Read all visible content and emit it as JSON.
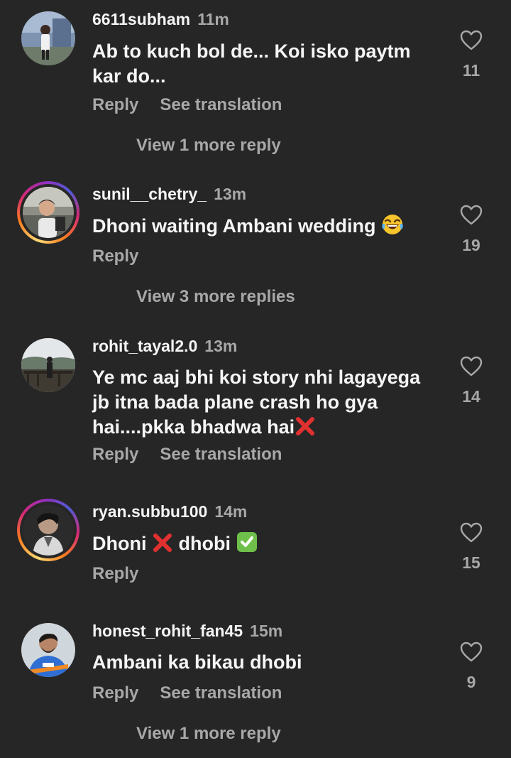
{
  "comments": [
    {
      "username": "6611subham",
      "time": "11m",
      "text": "Ab to kuch bol de... Koi isko paytm kar do...",
      "reply_label": "Reply",
      "translate_label": "See translation",
      "likes": "11",
      "view_more": "View 1 more reply"
    },
    {
      "username": "sunil__chetry_",
      "time": "13m",
      "text": "Dhoni waiting Ambani wedding",
      "emoji": "😂",
      "reply_label": "Reply",
      "likes": "19",
      "view_more": "View 3 more replies"
    },
    {
      "username": "rohit_tayal2.0",
      "time": "13m",
      "text": "Ye mc aaj bhi koi story nhi lagayega jb itna bada plane crash ho gya hai....pkka bhadwa hai",
      "reply_label": "Reply",
      "translate_label": "See translation",
      "likes": "14"
    },
    {
      "username": "ryan.subbu100",
      "time": "14m",
      "text_a": "Dhoni",
      "text_b": "dhobi",
      "reply_label": "Reply",
      "likes": "15"
    },
    {
      "username": "honest_rohit_fan45",
      "time": "15m",
      "text": "Ambani ka bikau dhobi",
      "reply_label": "Reply",
      "translate_label": "See translation",
      "likes": "9",
      "view_more": "View 1 more reply"
    }
  ],
  "colors": {
    "background": "#262626",
    "primary_text": "#f5f5f5",
    "secondary_text": "#a8a8a8",
    "cross_red": "#e0302f",
    "check_green": "#6ec04a"
  }
}
